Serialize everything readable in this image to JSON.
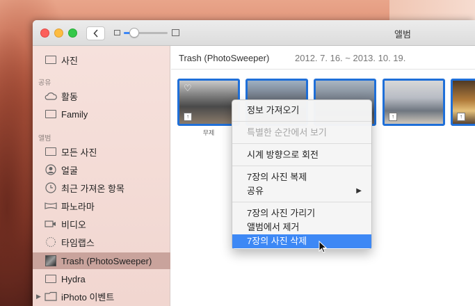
{
  "window": {
    "title": "앨범"
  },
  "toolbar": {
    "back_icon": "chevron-left-icon"
  },
  "sidebar": {
    "top_item": "사진",
    "sections": [
      "공유",
      "앨범"
    ],
    "shared_items": [
      "활동",
      "Family"
    ],
    "album_items": [
      "모든 사진",
      "얼굴",
      "최근 가져온 항목",
      "파노라마",
      "비디오",
      "타임랩스",
      "Trash (PhotoSweeper)",
      "Hydra",
      "iPhoto 이벤트"
    ],
    "selected_item": "Trash (PhotoSweeper)"
  },
  "main": {
    "album_name": "Trash (PhotoSweeper)",
    "date_range": "2012. 7. 16. ~ 2013. 10. 19.",
    "first_caption": "무제"
  },
  "context_menu": {
    "items": [
      {
        "label": "정보 가져오기",
        "state": "normal"
      },
      {
        "label": "특별한 순간에서 보기",
        "state": "disabled"
      },
      {
        "label": "시계 방향으로 회전",
        "state": "normal"
      },
      {
        "label": "7장의 사진 복제",
        "state": "normal"
      },
      {
        "label": "공유",
        "state": "normal",
        "submenu": true
      },
      {
        "label": "7장의 사진 가리기",
        "state": "normal"
      },
      {
        "label": "앨범에서 제거",
        "state": "normal"
      },
      {
        "label": "7장의 사진 삭제",
        "state": "highlighted"
      }
    ]
  },
  "colors": {
    "selection_blue": "#1f6fd8",
    "menu_highlight": "#3d88f5",
    "sidebar_selected": "#c9a39c"
  }
}
